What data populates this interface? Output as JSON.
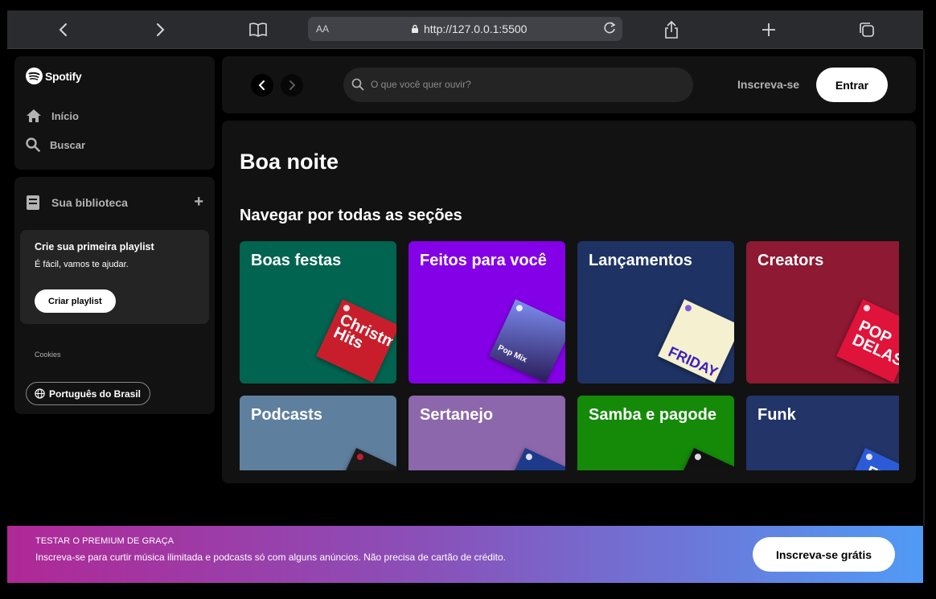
{
  "browser": {
    "address_prefix": "AA",
    "url": "http://127.0.0.1:5500"
  },
  "sidebar": {
    "logo_text": "Spotify",
    "nav": [
      {
        "label": "Início",
        "icon": "home-icon"
      },
      {
        "label": "Buscar",
        "icon": "search-icon"
      }
    ],
    "library": {
      "title": "Sua biblioteca",
      "add_icon": "plus-icon",
      "create_playlist": {
        "title": "Crie sua primeira playlist",
        "subtitle": "É fácil, vamos te ajudar.",
        "button": "Criar playlist"
      },
      "cookies": "Cookies",
      "language": "Português do Brasil"
    }
  },
  "topbar": {
    "search_placeholder": "O que você quer ouvir?",
    "signup": "Inscreva-se",
    "login": "Entrar"
  },
  "main": {
    "greeting": "Boa noite",
    "section_title": "Navegar por todas as seções",
    "cards": [
      {
        "title": "Boas festas",
        "color": "#006450",
        "art_text": "Christmas Hits",
        "art_color": "#c81e2c"
      },
      {
        "title": "Feitos para você",
        "color": "#8400e7",
        "art_text": "Pop Mix",
        "art_color": "#5b6bd8"
      },
      {
        "title": "Lançamentos",
        "color": "#1e3264",
        "art_text": "FRIDAY",
        "art_color": "#f4f0d0"
      },
      {
        "title": "Creators",
        "color": "#8d1932",
        "art_text": "POP DELAS",
        "art_color": "#e0133a"
      },
      {
        "title": "Podcasts",
        "color": "#5f7f9f",
        "art_text": "",
        "art_color": "#1a1a1a"
      },
      {
        "title": "Sertanejo",
        "color": "#8d67ab",
        "art_text": "",
        "art_color": "#1e3a8a"
      },
      {
        "title": "Samba e pagode",
        "color": "#148a08",
        "art_text": "",
        "art_color": "#111111"
      },
      {
        "title": "Funk",
        "color": "#223468",
        "art_text": "FU",
        "art_color": "#2b5bd6"
      }
    ]
  },
  "banner": {
    "heading": "TESTAR O PREMIUM DE GRAÇA",
    "description": "Inscreva-se para curtir música ilimitada e podcasts só com alguns anúncios. Não precisa de cartão de crédito.",
    "cta": "Inscreva-se grátis"
  }
}
